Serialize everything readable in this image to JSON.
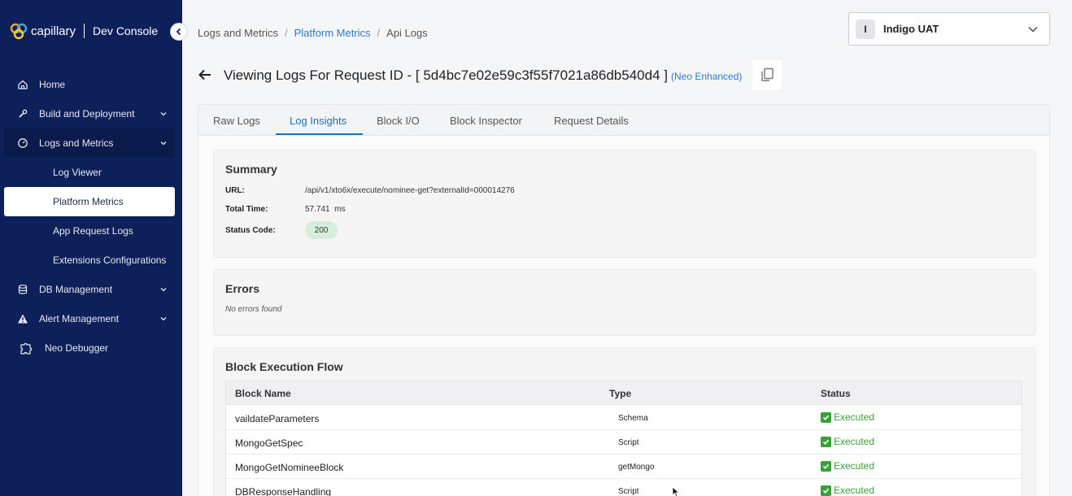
{
  "brand": {
    "name": "capillary",
    "product": "Dev Console"
  },
  "sidebar": {
    "items": [
      {
        "label": "Home",
        "icon": "home-icon"
      },
      {
        "label": "Build and Deployment",
        "icon": "wrench-icon"
      },
      {
        "label": "Logs and Metrics",
        "icon": "gauge-icon"
      },
      {
        "label": "Log Viewer"
      },
      {
        "label": "Platform Metrics"
      },
      {
        "label": "App Request Logs"
      },
      {
        "label": "Extensions Configurations"
      },
      {
        "label": "DB Management",
        "icon": "database-icon"
      },
      {
        "label": "Alert Management",
        "icon": "alert-icon"
      },
      {
        "label": "Neo Debugger",
        "icon": "puzzle-icon"
      }
    ]
  },
  "breadcrumb": {
    "item1": "Logs and Metrics",
    "sep": "/",
    "item2": "Platform Metrics",
    "item3": "Api Logs"
  },
  "org": {
    "initial": "I",
    "name": "Indigo UAT"
  },
  "page": {
    "title": "Viewing Logs For Request ID - [ 5d4bc7e02e59c3f55f7021a86db540d4 ]",
    "tag": "(Neo Enhanced)"
  },
  "tabs": [
    "Raw Logs",
    "Log Insights",
    "Block I/O",
    "Block Inspector",
    "Request Details"
  ],
  "summary": {
    "title": "Summary",
    "url_label": "URL:",
    "url_value": "/api/v1/xto6x/execute/nominee-get?externalId=000014276",
    "time_label": "Total Time:",
    "time_value": "57.741  ms",
    "status_label": "Status Code:",
    "status_value": "200"
  },
  "errors": {
    "title": "Errors",
    "message": "No errors found"
  },
  "flow": {
    "title": "Block Execution Flow",
    "headers": {
      "name": "Block Name",
      "type": "Type",
      "status": "Status"
    },
    "rows": [
      {
        "name": "vaildateParameters",
        "type": "Schema",
        "status": "Executed"
      },
      {
        "name": "MongoGetSpec",
        "type": "Script",
        "status": "Executed"
      },
      {
        "name": "MongoGetNomineeBlock",
        "type": "getMongo",
        "status": "Executed"
      },
      {
        "name": "DBResponseHandling",
        "type": "Script",
        "status": "Executed"
      }
    ]
  },
  "colors": {
    "sidebar": "#0d2059",
    "accent": "#1d6fb8",
    "success": "#3aa13a"
  }
}
